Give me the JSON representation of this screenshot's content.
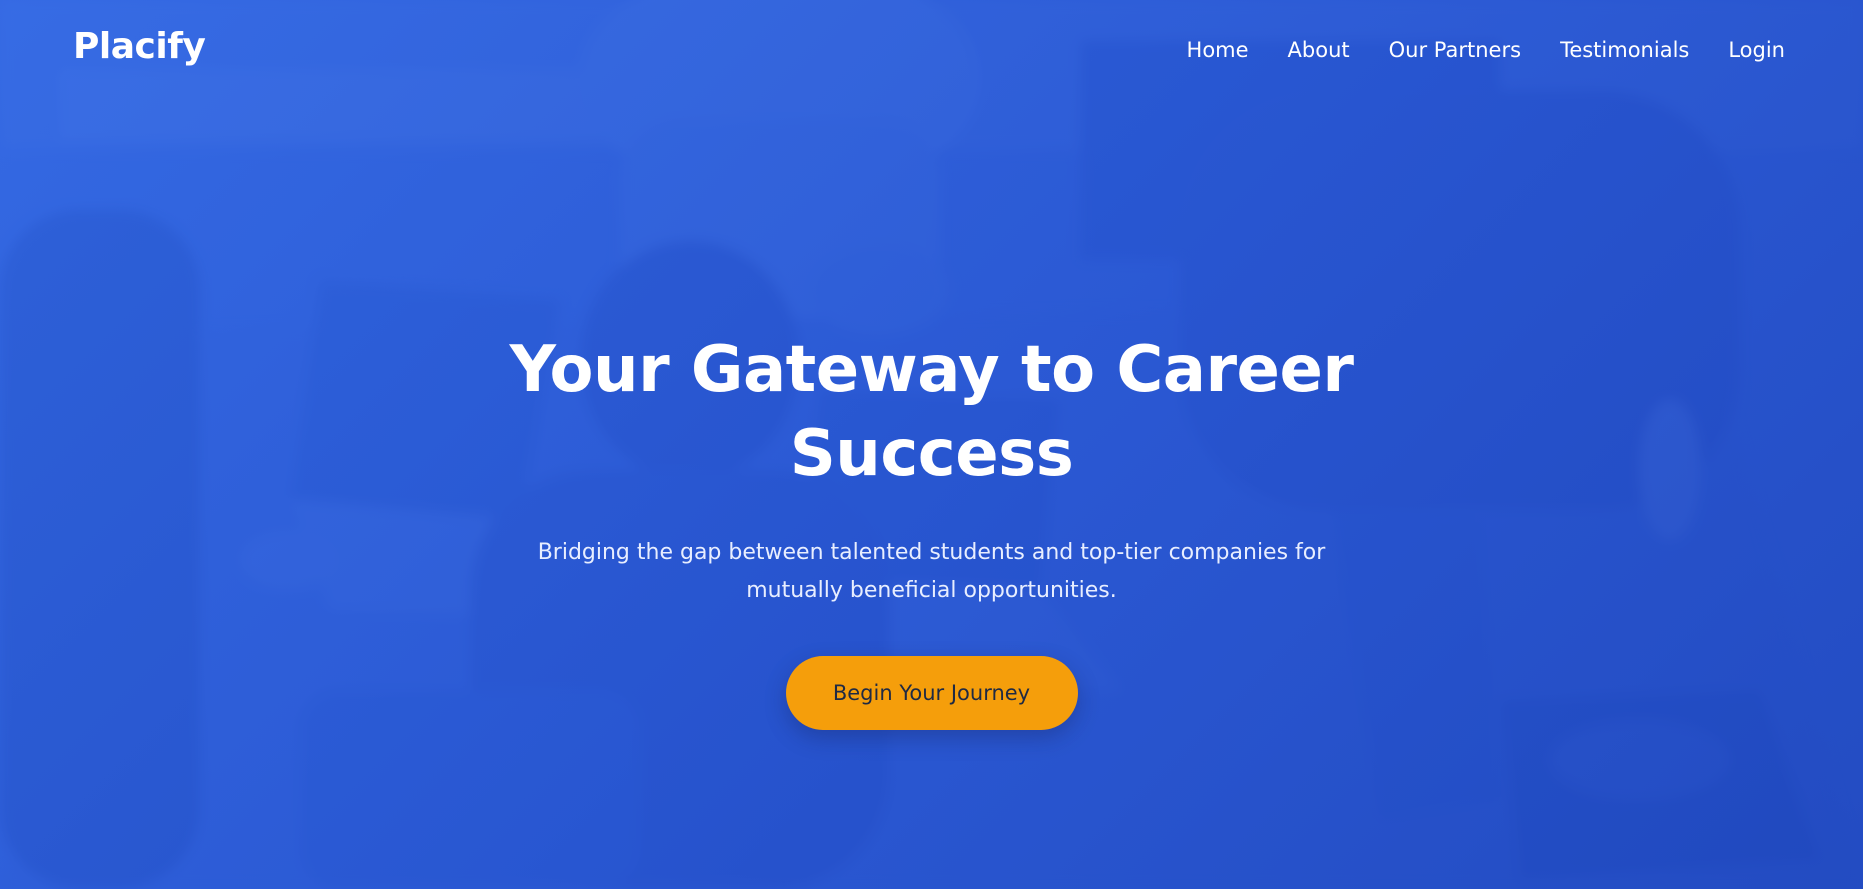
{
  "brand": {
    "name": "Placify"
  },
  "nav": {
    "items": [
      {
        "label": "Home"
      },
      {
        "label": "About"
      },
      {
        "label": "Our Partners"
      },
      {
        "label": "Testimonials"
      },
      {
        "label": "Login"
      }
    ]
  },
  "hero": {
    "headline_line1": "Your Gateway to Career",
    "headline_line2": "Success",
    "subtext_line1": "Bridging the gap between talented students and top-tier companies for",
    "subtext_line2": "mutually beneficial opportunities.",
    "cta_label": "Begin Your Journey"
  },
  "colors": {
    "overlay_blue": "#2f5fd6",
    "cta_orange": "#f59e0b",
    "cta_text": "#1f2a44",
    "text_white": "#ffffff"
  }
}
